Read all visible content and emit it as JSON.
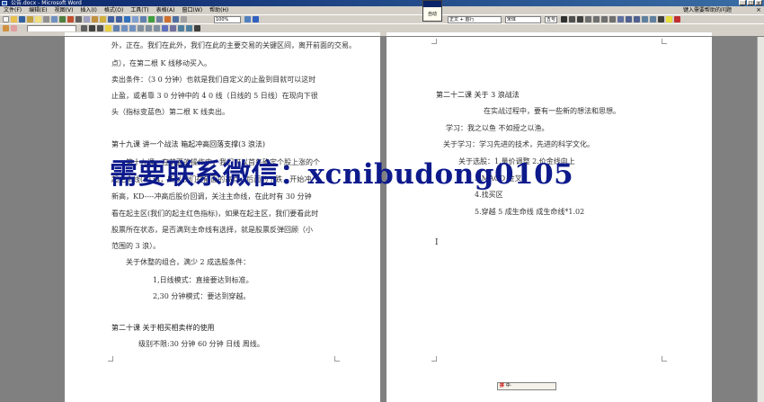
{
  "window": {
    "title": "公告.docx - Microsoft Word",
    "controls": [
      "_",
      "□",
      "×"
    ]
  },
  "menubar": {
    "items": [
      "文件(F)",
      "编辑(E)",
      "视图(V)",
      "插入(I)",
      "格式(O)",
      "工具(T)",
      "表格(A)",
      "窗口(W)",
      "帮助(H)"
    ],
    "help_prompt": "键入需要帮助的问题",
    "close_label": "×"
  },
  "toolbar": {
    "zoom": "100%",
    "style": "正文 + 首行",
    "font": "宋体",
    "size": "五号"
  },
  "float_tip": {
    "label": "自动"
  },
  "left_page": {
    "lines": [
      "外，正在。我们在此外，我们在此的主要交易的关键区间，离开前面的交易。",
      "点），在第二根 K 线移动买入。",
      "卖出条件：（3 0 分钟）也就是我们自定义的止盈到目就可以这时",
      "止盈，或者靠 3 0 分钟中的 4 0 线（日线的 5 日线）在现向下很",
      "头（指标变蓝色）第二根 K 线卖出。",
      "第十九课  讲一个战法  箱起冲高回落支撑(3 浪法)",
      "第十九课，在前面的操作中，我们可以首先确定个股上涨的个",
      "起主命线(B)34，所以我们在前面的高点，后面的下跌，开始冲",
      "新高，KD----冲高后股价回调，关注主命线，在此时有 30 分钟",
      "看在起主区(我们的起主红色指标)，如果在起主区，我们要看此时",
      "股票所在状态，是否满到主命线有选择，就是股票反弹回顾（小",
      "范围的 3 浪）。",
      "关于休整的组合，满少 2 成选股条件：",
      "1,日线模式：直接要达到标准。",
      "2,30 分钟模式：要达到穿越。",
      "第二十课  关于相买相卖样的使用",
      "级别不限:30 分钟  60 分钟  日线  周线。"
    ]
  },
  "right_page": {
    "lines": [
      "第二十二课  关于 3 浪战法",
      "在实战过程中，要有一些新的想法和思想。",
      "学习：我之以鱼  不如授之以渔。",
      "关于学习：学习先进的技术，先进的科学文化。",
      "关于选股：1.量价调整 2.价金线向上",
      "3.MACD 金叉",
      "4.找买区",
      "5.穿越 5  成生命线  成生命线*1.02"
    ]
  },
  "watermark": {
    "text": "需要联系微信：xcnibudong0105"
  },
  "ime_bar": {
    "text": "中·"
  }
}
